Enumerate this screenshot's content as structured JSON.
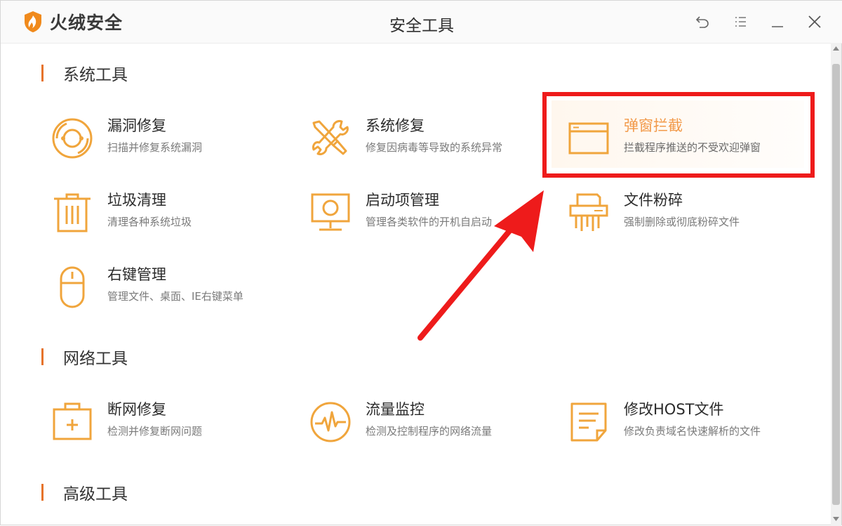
{
  "app": {
    "name": "火绒安全",
    "window_title": "安全工具"
  },
  "colors": {
    "accent": "#f0a53c",
    "section_bar": "#e6732b",
    "annotation": "#ee1b1b"
  },
  "titlebar_controls": [
    "back-icon",
    "menu-icon",
    "minimize-icon",
    "close-icon"
  ],
  "sections": [
    {
      "title": "系统工具",
      "tools": [
        {
          "name": "漏洞修复",
          "desc": "扫描并修复系统漏洞",
          "icon": "vulnerability-fix-icon"
        },
        {
          "name": "系统修复",
          "desc": "修复因病毒等导致的系统异常",
          "icon": "system-repair-icon"
        },
        {
          "name": "弹窗拦截",
          "desc": "拦截程序推送的不受欢迎弹窗",
          "icon": "popup-block-icon"
        },
        {
          "name": "垃圾清理",
          "desc": "清理各种系统垃圾",
          "icon": "trash-icon"
        },
        {
          "name": "启动项管理",
          "desc": "管理各类软件的开机自启动",
          "icon": "monitor-icon"
        },
        {
          "name": "文件粉碎",
          "desc": "强制删除或彻底粉碎文件",
          "icon": "shredder-icon"
        },
        {
          "name": "右键管理",
          "desc": "管理文件、桌面、IE右键菜单",
          "icon": "mouse-icon"
        }
      ]
    },
    {
      "title": "网络工具",
      "tools": [
        {
          "name": "断网修复",
          "desc": "检测并修复断网问题",
          "icon": "toolbox-icon"
        },
        {
          "name": "流量监控",
          "desc": "检测及控制程序的网络流量",
          "icon": "traffic-monitor-icon"
        },
        {
          "name": "修改HOST文件",
          "desc": "修改负责域名快速解析的文件",
          "icon": "host-file-icon"
        }
      ]
    },
    {
      "title": "高级工具",
      "tools": []
    }
  ]
}
